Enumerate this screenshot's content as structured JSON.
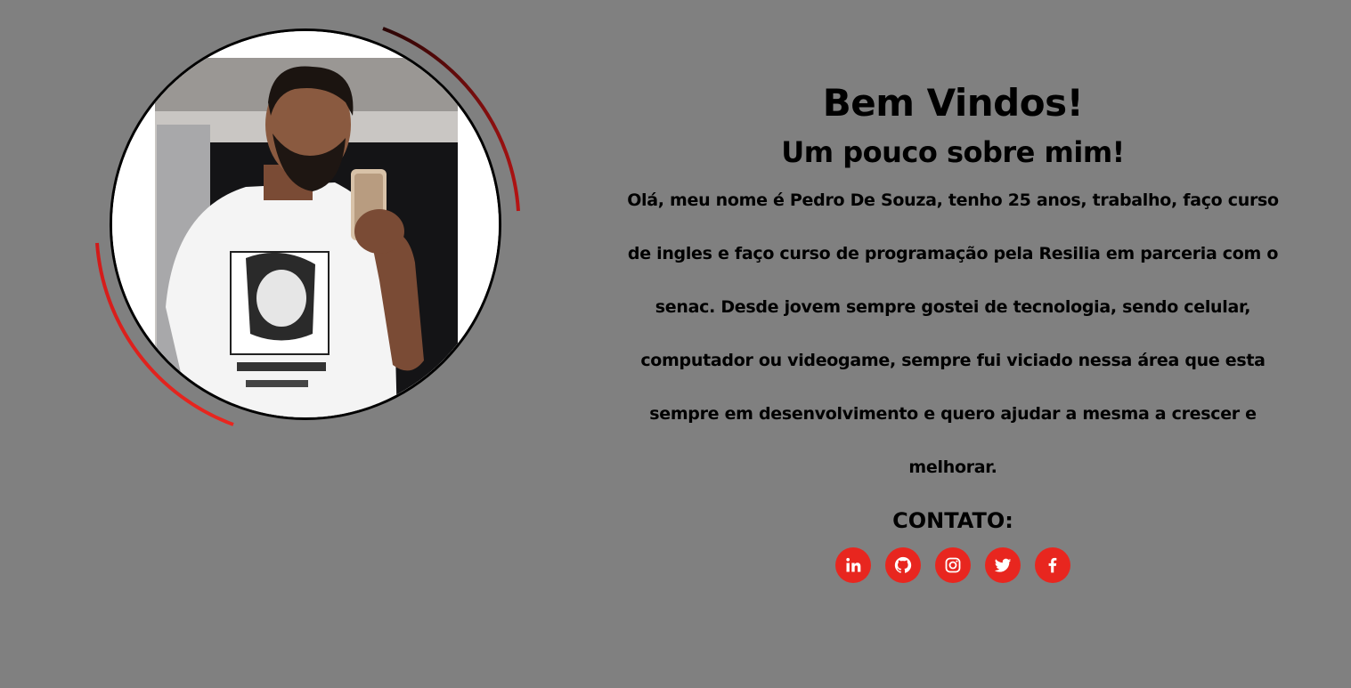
{
  "hero": {
    "title": "Bem Vindos!",
    "subtitle": "Um pouco sobre mim!",
    "bio": "Olá, meu nome é Pedro De Souza, tenho 25 anos, trabalho, faço curso de ingles e faço curso de programação pela Resilia em parceria com o senac. Desde jovem sempre gostei de tecnologia, sendo celular, computador ou videogame, sempre fui viciado nessa área que esta sempre em desenvolvimento e quero ajudar a mesma a crescer e melhorar.",
    "contact_title": "CONTATO:"
  },
  "socials": [
    {
      "icon": "linkedin-icon"
    },
    {
      "icon": "github-icon"
    },
    {
      "icon": "instagram-icon"
    },
    {
      "icon": "twitter-icon"
    },
    {
      "icon": "facebook-icon"
    }
  ],
  "colors": {
    "background": "#808080",
    "accent": "#e8261f",
    "arc_dark": "#3a0a0a"
  }
}
